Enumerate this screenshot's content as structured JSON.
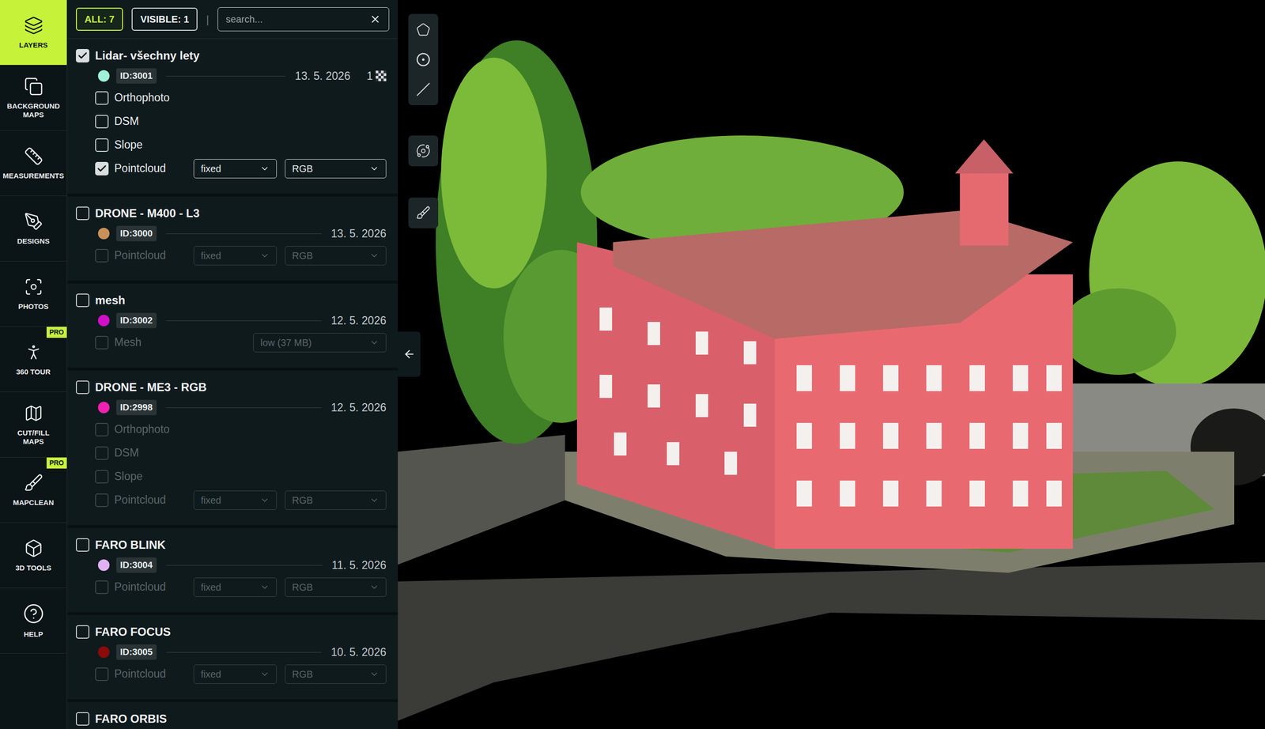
{
  "nav": [
    {
      "lines": [
        "LAYERS"
      ],
      "selected": true
    },
    {
      "lines": [
        "BACKGROUND",
        "MAPS"
      ],
      "selected": false
    },
    {
      "lines": [
        "MEASUREMENTS"
      ],
      "selected": false
    },
    {
      "lines": [
        "DESIGNS"
      ],
      "selected": false
    },
    {
      "lines": [
        "PHOTOS"
      ],
      "selected": false
    },
    {
      "lines": [
        "360 TOUR"
      ],
      "selected": false,
      "badge": "PRO"
    },
    {
      "lines": [
        "CUT/FILL",
        "MAPS"
      ],
      "selected": false
    },
    {
      "lines": [
        "MAPCLEAN"
      ],
      "selected": false,
      "badge": "PRO"
    },
    {
      "lines": [
        "3D TOOLS"
      ],
      "selected": false
    },
    {
      "lines": [
        "HELP"
      ],
      "selected": false
    }
  ],
  "header": {
    "all": "ALL: 7",
    "visible": "VISIBLE: 1",
    "separator": "|",
    "search_placeholder": "search..."
  },
  "layers": [
    {
      "name": "Lidar- všechny lety",
      "checked": true,
      "color": "#9ff2d8",
      "id": "ID:3001",
      "date": "13. 5. 2026",
      "count": "1",
      "sublayers": [
        {
          "kind": "check",
          "label": "Orthophoto",
          "checked": false,
          "disabled": false
        },
        {
          "kind": "check",
          "label": "DSM",
          "checked": false,
          "disabled": false
        },
        {
          "kind": "check",
          "label": "Slope",
          "checked": false,
          "disabled": false
        },
        {
          "kind": "pointcloud",
          "label": "Pointcloud",
          "checked": true,
          "disabled": false,
          "mode": "fixed",
          "coloring": "RGB"
        }
      ]
    },
    {
      "name": "DRONE - M400 - L3",
      "checked": false,
      "color": "#c8915a",
      "id": "ID:3000",
      "date": "13. 5. 2026",
      "sublayers": [
        {
          "kind": "pointcloud",
          "label": "Pointcloud",
          "checked": false,
          "disabled": true,
          "mode": "fixed",
          "coloring": "RGB"
        }
      ]
    },
    {
      "name": "mesh",
      "checked": false,
      "color": "#d010c8",
      "id": "ID:3002",
      "date": "12. 5. 2026",
      "sublayers": [
        {
          "kind": "mesh",
          "label": "Mesh",
          "checked": false,
          "disabled": true,
          "quality": "low (37 MB)"
        }
      ]
    },
    {
      "name": "DRONE - ME3 - RGB",
      "checked": false,
      "color": "#f020b0",
      "id": "ID:2998",
      "date": "12. 5. 2026",
      "sublayers": [
        {
          "kind": "check",
          "label": "Orthophoto",
          "checked": false,
          "disabled": true
        },
        {
          "kind": "check",
          "label": "DSM",
          "checked": false,
          "disabled": true
        },
        {
          "kind": "check",
          "label": "Slope",
          "checked": false,
          "disabled": true
        },
        {
          "kind": "pointcloud",
          "label": "Pointcloud",
          "checked": false,
          "disabled": true,
          "mode": "fixed",
          "coloring": "RGB"
        }
      ]
    },
    {
      "name": "FARO BLINK",
      "checked": false,
      "color": "#e0b0f0",
      "id": "ID:3004",
      "date": "11. 5. 2026",
      "sublayers": [
        {
          "kind": "pointcloud",
          "label": "Pointcloud",
          "checked": false,
          "disabled": true,
          "mode": "fixed",
          "coloring": "RGB"
        }
      ]
    },
    {
      "name": "FARO FOCUS",
      "checked": false,
      "color": "#8b0a0a",
      "id": "ID:3005",
      "date": "10. 5. 2026",
      "sublayers": [
        {
          "kind": "pointcloud",
          "label": "Pointcloud",
          "checked": false,
          "disabled": true,
          "mode": "fixed",
          "coloring": "RGB"
        }
      ]
    },
    {
      "name": "FARO ORBIS",
      "checked": false,
      "sublayers": []
    }
  ]
}
